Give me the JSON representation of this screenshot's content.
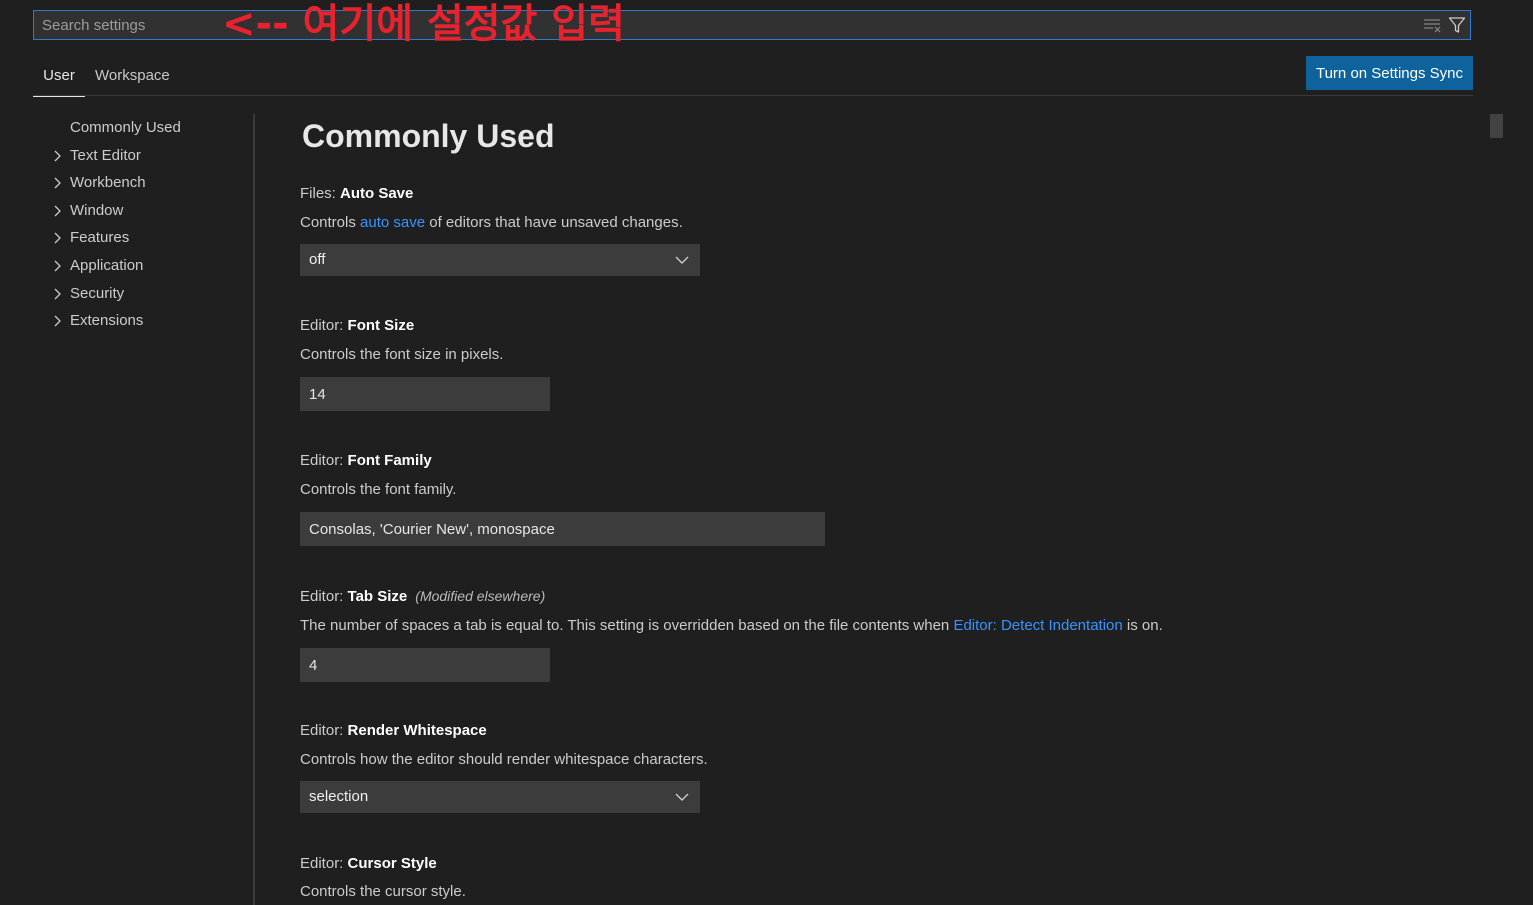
{
  "search": {
    "placeholder": "Search settings",
    "annotation": "<-- 여기에 설정값 입력",
    "clear_icon": "clear-filter-icon",
    "filter_icon": "filter-icon"
  },
  "tabs": [
    {
      "label": "User",
      "active": true
    },
    {
      "label": "Workspace",
      "active": false
    }
  ],
  "sync_button": {
    "label": "Turn on Settings Sync"
  },
  "toc": {
    "items": [
      {
        "label": "Commonly Used",
        "expandable": false
      },
      {
        "label": "Text Editor",
        "expandable": true
      },
      {
        "label": "Workbench",
        "expandable": true
      },
      {
        "label": "Window",
        "expandable": true
      },
      {
        "label": "Features",
        "expandable": true
      },
      {
        "label": "Application",
        "expandable": true
      },
      {
        "label": "Security",
        "expandable": true
      },
      {
        "label": "Extensions",
        "expandable": true
      }
    ]
  },
  "section": {
    "title": "Commonly Used"
  },
  "settings": {
    "auto_save": {
      "category": "Files: ",
      "key": "Auto Save",
      "desc_before": "Controls ",
      "desc_link": "auto save",
      "desc_after": " of editors that have unsaved changes.",
      "value": "off"
    },
    "font_size": {
      "category": "Editor: ",
      "key": "Font Size",
      "desc": "Controls the font size in pixels.",
      "value": "14"
    },
    "font_family": {
      "category": "Editor: ",
      "key": "Font Family",
      "desc": "Controls the font family.",
      "value": "Consolas, 'Courier New', monospace"
    },
    "tab_size": {
      "category": "Editor: ",
      "key": "Tab Size",
      "modified": "(Modified elsewhere)",
      "desc_before": "The number of spaces a tab is equal to. This setting is overridden based on the file contents when ",
      "desc_link": "Editor: Detect Indentation",
      "desc_after": " is on.",
      "value": "4"
    },
    "render_whitespace": {
      "category": "Editor: ",
      "key": "Render Whitespace",
      "desc": "Controls how the editor should render whitespace characters.",
      "value": "selection"
    },
    "cursor_style": {
      "category": "Editor: ",
      "key": "Cursor Style",
      "desc": "Controls the cursor style."
    }
  },
  "colors": {
    "background": "#1f1f1f",
    "accent": "#0e639c",
    "link": "#3794ff",
    "focus_border": "#2b79d0",
    "annotation": "#e8222e"
  }
}
